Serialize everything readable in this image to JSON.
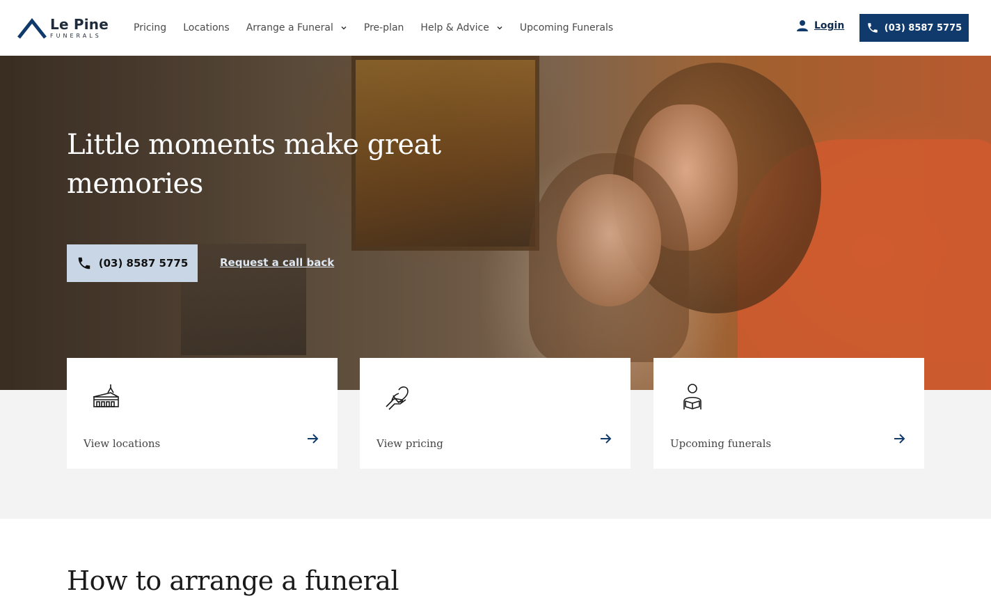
{
  "brand": {
    "name": "Le Pine",
    "tagline": "FUNERALS",
    "color": "#0f3a6b"
  },
  "nav": {
    "items": [
      {
        "label": "Pricing",
        "dropdown": false
      },
      {
        "label": "Locations",
        "dropdown": false
      },
      {
        "label": "Arrange a Funeral",
        "dropdown": true
      },
      {
        "label": "Pre-plan",
        "dropdown": false
      },
      {
        "label": "Help & Advice",
        "dropdown": true
      },
      {
        "label": "Upcoming Funerals",
        "dropdown": false
      }
    ],
    "login_label": "Login",
    "phone_label": "(03) 8587 5775"
  },
  "hero": {
    "title": "Little moments make great memories",
    "phone_label": "(03) 8587 5775",
    "callback_label": "Request a call back"
  },
  "cards": [
    {
      "label": "View locations",
      "icon": "church-icon"
    },
    {
      "label": "View pricing",
      "icon": "hand-heart-icon"
    },
    {
      "label": "Upcoming funerals",
      "icon": "person-book-icon"
    }
  ],
  "section": {
    "title": "How to arrange a funeral"
  },
  "colors": {
    "accent": "#0f3a6b",
    "hero_button_bg": "#c8d6e6",
    "band_bg": "#f3f3f3"
  }
}
